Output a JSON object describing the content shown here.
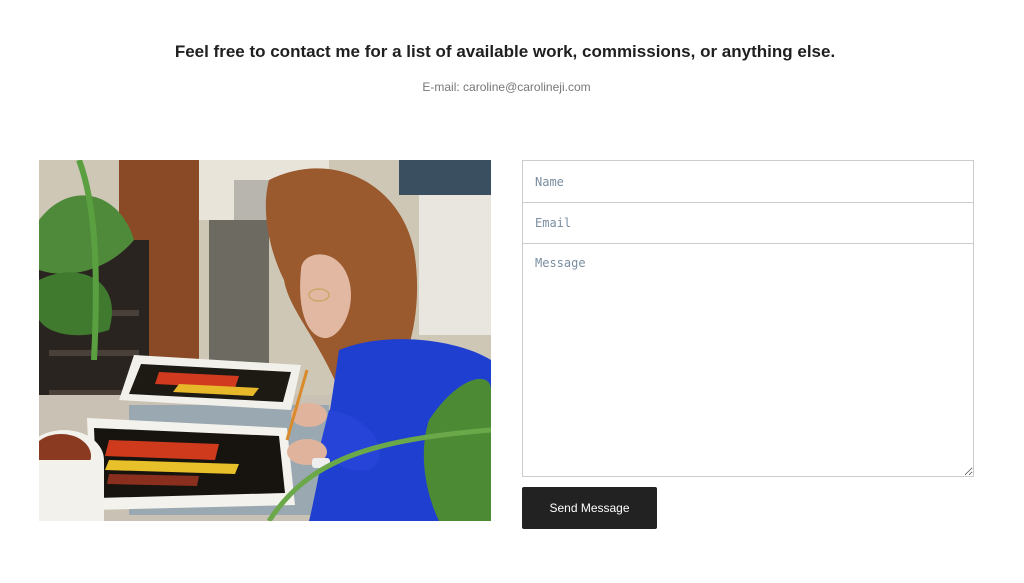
{
  "contact": {
    "heading": "Feel free to contact me for a list of available work, commissions, or anything else.",
    "email_line": "E-mail: caroline@carolineji.com"
  },
  "photo": {
    "subject": "artist-at-work-photo"
  },
  "form": {
    "name_placeholder": "Name",
    "email_placeholder": "Email",
    "message_placeholder": "Message",
    "submit_label": "Send Message"
  },
  "colors": {
    "button_bg": "#222222",
    "button_text": "#ffffff",
    "field_border": "#cccccc",
    "placeholder": "#7a8ea0"
  }
}
